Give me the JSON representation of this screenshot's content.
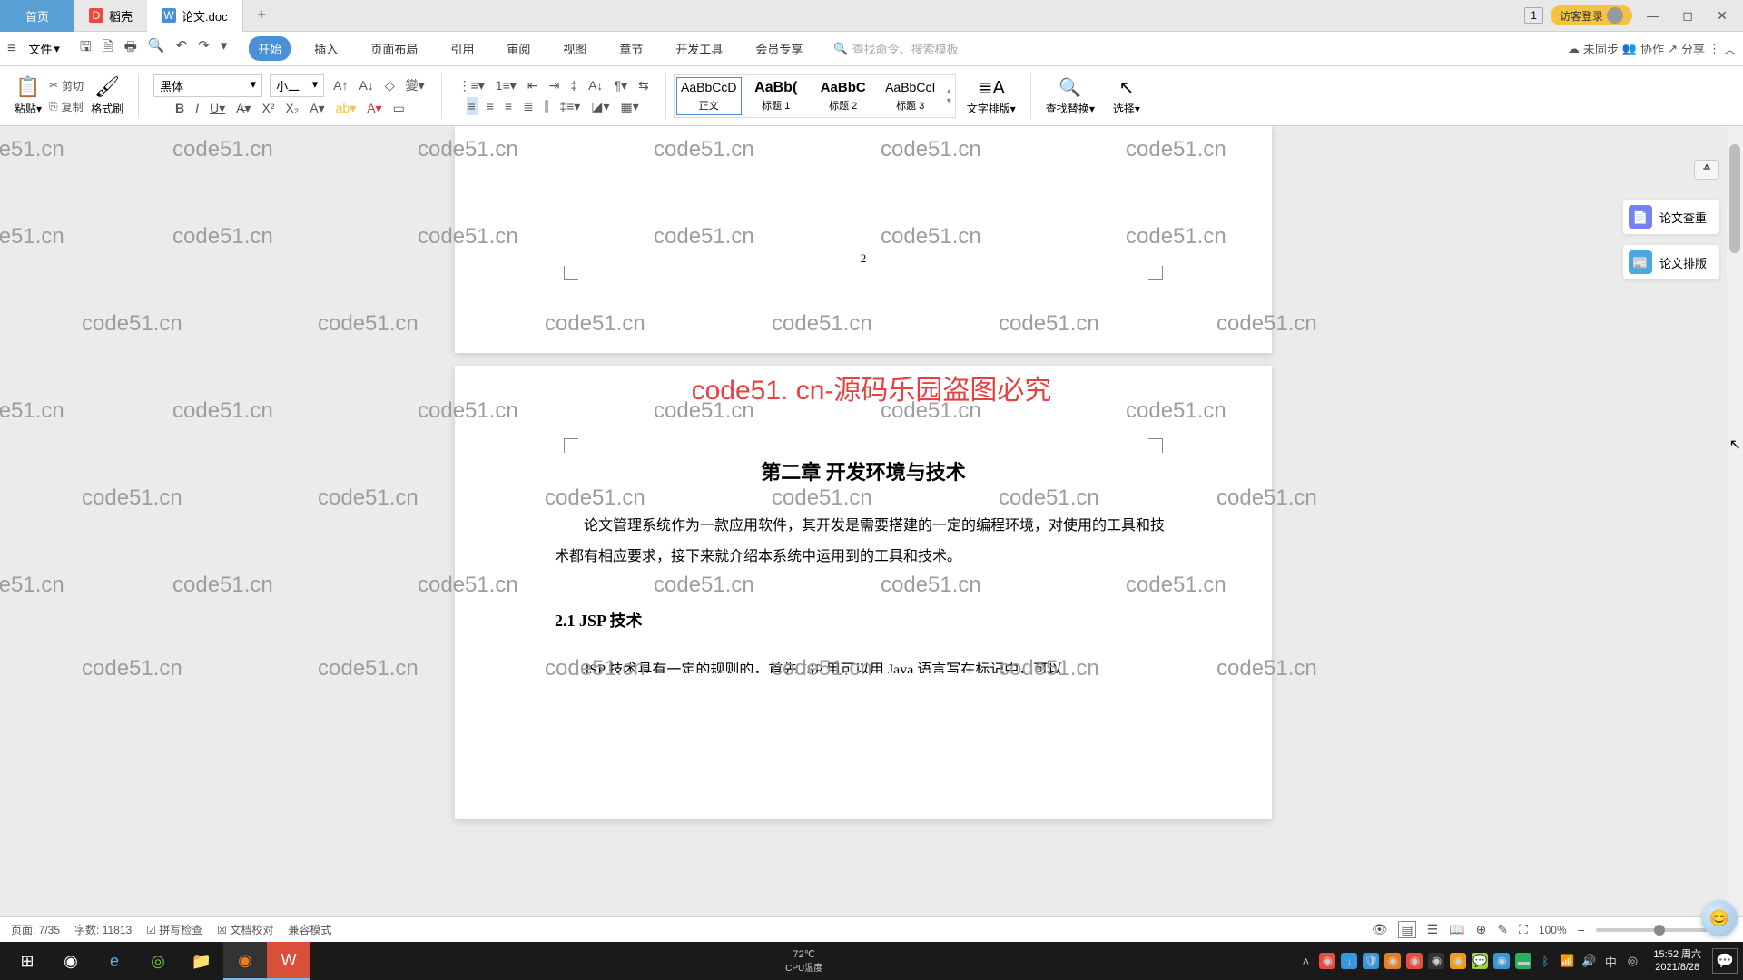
{
  "tabs": {
    "home": "首页",
    "daoke": "稻壳",
    "doc": "论文.doc"
  },
  "titlebar": {
    "badge": "1",
    "login": "访客登录"
  },
  "menu": {
    "file": "文件",
    "items": [
      "开始",
      "插入",
      "页面布局",
      "引用",
      "审阅",
      "视图",
      "章节",
      "开发工具",
      "会员专享"
    ],
    "search_placeholder": "查找命令、搜索模板",
    "unsync": "未同步",
    "collab": "协作",
    "share": "分享"
  },
  "ribbon": {
    "paste": "粘贴",
    "cut": "剪切",
    "copy": "复制",
    "format_painter": "格式刷",
    "font_name": "黑体",
    "font_size": "小二",
    "styles": [
      {
        "preview": "AaBbCcD",
        "name": "正文"
      },
      {
        "preview": "AaBb(",
        "name": "标题 1"
      },
      {
        "preview": "AaBbC",
        "name": "标题 2"
      },
      {
        "preview": "AaBbCcI",
        "name": "标题 3"
      }
    ],
    "text_layout": "文字排版",
    "find_replace": "查找替换",
    "select": "选择"
  },
  "side": {
    "check": "论文查重",
    "layout": "论文排版"
  },
  "document": {
    "page_num_prev": "2",
    "red_banner": "code51. cn-源码乐园盗图必究",
    "chapter": "第二章  开发环境与技术",
    "para1": "论文管理系统作为一款应用软件，其开发是需要搭建的一定的编程环境，对使用的工具和技术都有相应要求，接下来就介绍本系统中运用到的工具和技术。",
    "section": "2.1 JSP 技术",
    "cut": "JSP 技术具有一定的规则的，首先 JSP 用可以用 Java 语言写在标记中，可以"
  },
  "watermark": "code51.cn",
  "status": {
    "page": "页面: 7/35",
    "words": "字数: 11813",
    "spell": "拼写检查",
    "proof": "文档校对",
    "compat": "兼容模式",
    "zoom": "100%"
  },
  "taskbar": {
    "cpu_label": "CPU温度",
    "temp": "72℃",
    "time": "15:52",
    "day": "周六",
    "date": "2021/8/28"
  }
}
